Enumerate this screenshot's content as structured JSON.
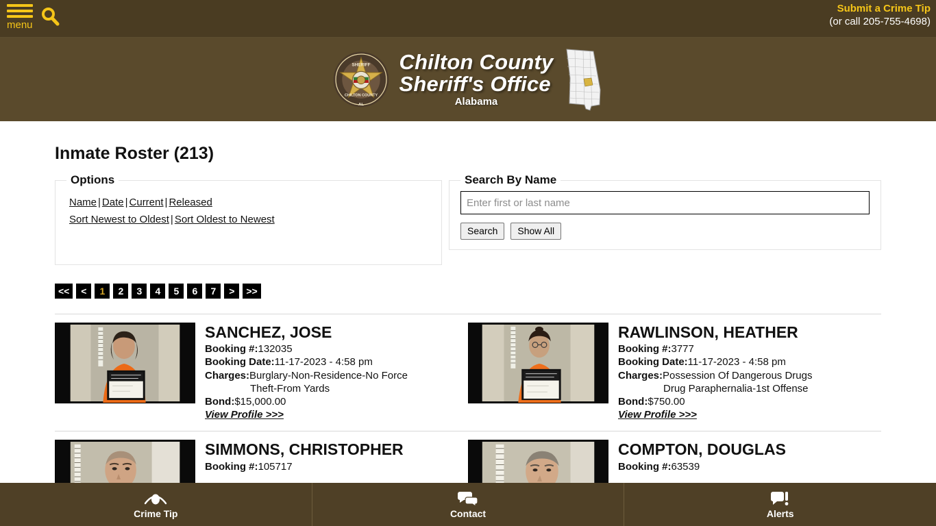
{
  "topbar": {
    "menu_label": "menu",
    "menu_icon": "hamburger-icon",
    "search_icon": "search-icon",
    "crime_tip_link": "Submit a Crime Tip",
    "crime_tip_phone": "(or call 205-755-4698)"
  },
  "brand": {
    "line1": "Chilton County",
    "line2": "Sheriff's Office",
    "state": "Alabama",
    "badge_icon": "sheriff-badge-icon",
    "map_icon": "alabama-map-icon",
    "badge_text_top": "SHERIFF",
    "badge_text_bottom": "CHILTON COUNTY",
    "badge_text_state": "AL"
  },
  "page": {
    "title": "Inmate Roster (213)"
  },
  "options": {
    "legend": "Options",
    "links_row1": [
      "Name",
      "Date",
      "Current",
      "Released"
    ],
    "links_row2": [
      "Sort Newest to Oldest",
      "Sort Oldest to Newest"
    ],
    "separator": "|"
  },
  "search": {
    "legend": "Search By Name",
    "placeholder": "Enter first or last name",
    "value": "",
    "search_button": "Search",
    "show_all_button": "Show All"
  },
  "pagination": {
    "first": "<<",
    "prev": "<",
    "pages": [
      "1",
      "2",
      "3",
      "4",
      "5",
      "6",
      "7"
    ],
    "active": "1",
    "next": ">",
    "last": ">>"
  },
  "labels": {
    "booking_num": "Booking #:",
    "booking_date": "Booking Date:",
    "charges": "Charges:",
    "bond": "Bond:",
    "view_profile": "View Profile >>>"
  },
  "inmates": [
    {
      "name": "SANCHEZ, JOSE",
      "booking_num": "132035",
      "booking_date": "11-17-2023 - 4:58 pm",
      "charge1": "Burglary-Non-Residence-No Force",
      "charge2": "Theft-From Yards",
      "bond": "$15,000.00",
      "mugshot_board": "Sanchez, Jose Angel"
    },
    {
      "name": "RAWLINSON, HEATHER",
      "booking_num": "3777",
      "booking_date": "11-17-2023 - 4:58 pm",
      "charge1": "Possession Of Dangerous Drugs",
      "charge2": "Drug Paraphernalia-1st Offense",
      "bond": "$750.00",
      "mugshot_board": "Rawlinson, Heather Denise"
    },
    {
      "name": "SIMMONS, CHRISTOPHER",
      "booking_num": "105717",
      "booking_date": "",
      "charge1": "",
      "charge2": "",
      "bond": "",
      "mugshot_board": ""
    },
    {
      "name": "COMPTON, DOUGLAS",
      "booking_num": "63539",
      "booking_date": "",
      "charge1": "",
      "charge2": "",
      "bond": "",
      "mugshot_board": ""
    }
  ],
  "footer": {
    "items": [
      {
        "label": "Crime Tip",
        "icon": "eye-icon"
      },
      {
        "label": "Contact",
        "icon": "chat-bubbles-icon"
      },
      {
        "label": "Alerts",
        "icon": "alert-bubble-icon"
      }
    ]
  },
  "colors": {
    "topbar_bg": "#4a3c22",
    "brandbar_bg": "#5a4a2c",
    "footer_bg": "#4f4026",
    "accent_yellow": "#f5c518",
    "pager_active": "#d6a829"
  }
}
